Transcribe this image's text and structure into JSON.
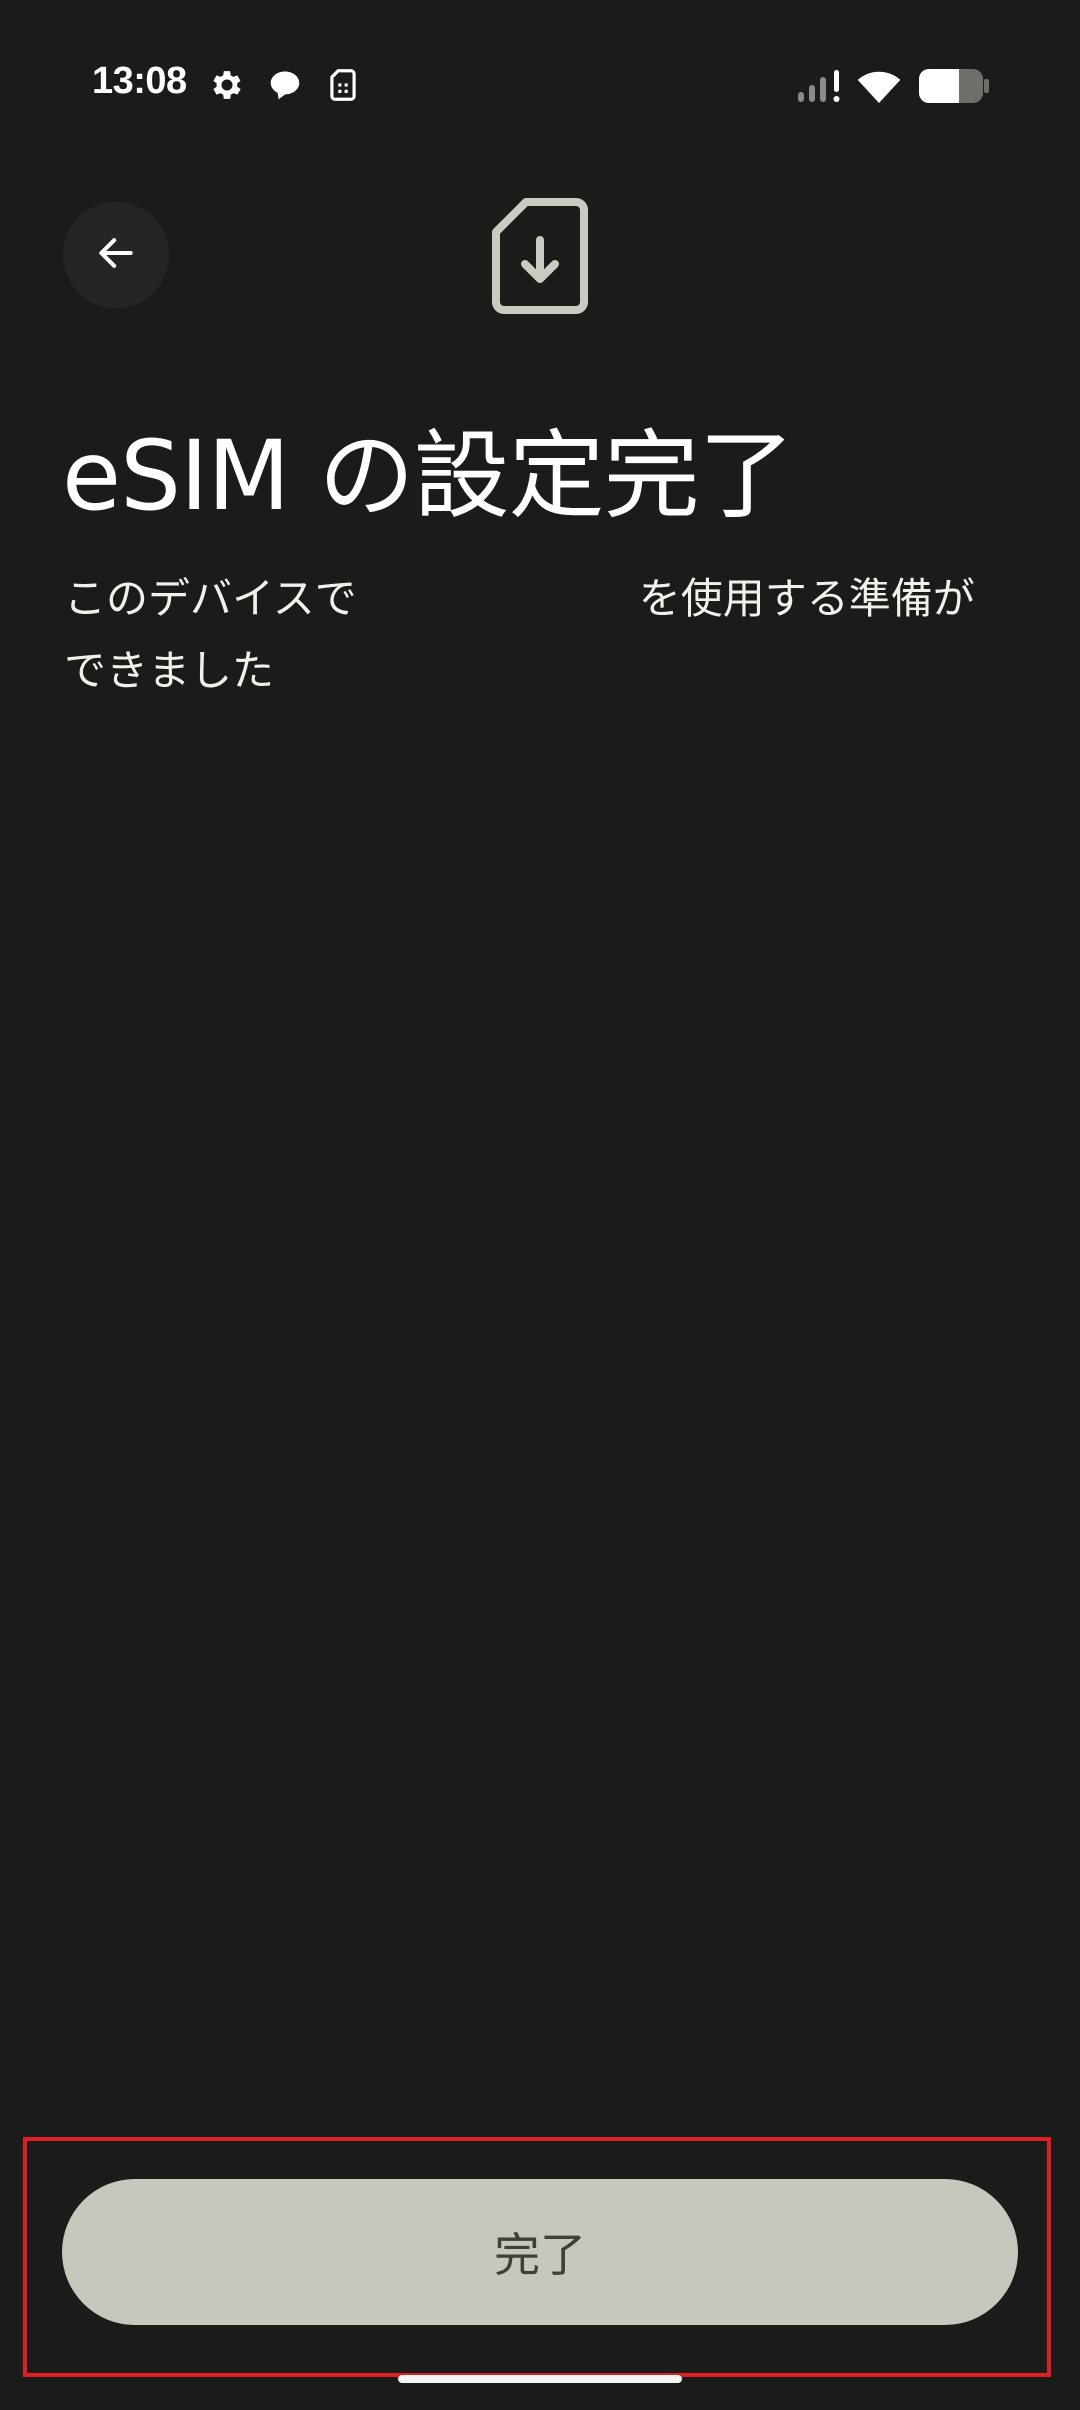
{
  "status_bar": {
    "time": "13:08",
    "left_icons": [
      "gear-icon",
      "chat-bubble-icon",
      "sim-card-icon"
    ],
    "right_icons": [
      "signal-no-service-icon",
      "wifi-icon",
      "battery-icon"
    ],
    "battery_level": 0.6
  },
  "header": {
    "back_icon": "arrow-left-icon",
    "illustration_icon": "sim-download-icon"
  },
  "main": {
    "title": "eSIM の設定完了",
    "description_line1_start": "このデバイスで",
    "description_line1_end": "を使用する準備が",
    "description_line2": "できました"
  },
  "footer": {
    "done_label": "完了"
  },
  "colors": {
    "background": "#1b1b19",
    "button_background": "#c5c8bc",
    "button_text": "#3f4039",
    "highlight": "#e01e25",
    "icon": "#c9cbc0"
  }
}
